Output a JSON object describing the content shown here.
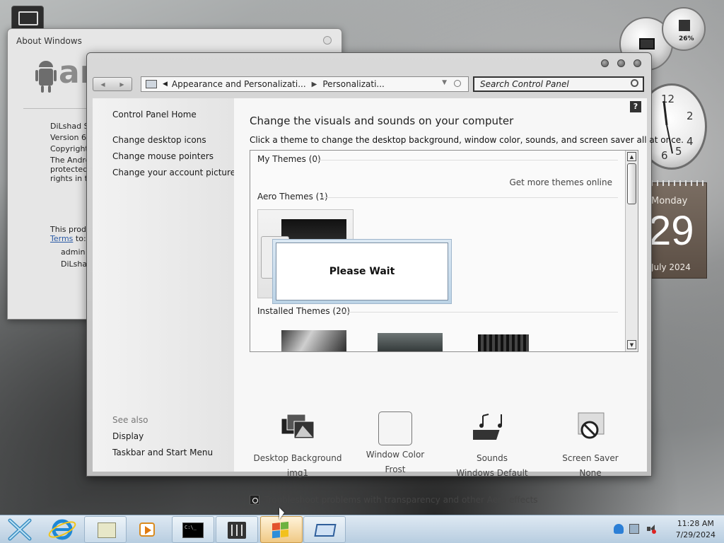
{
  "about_window": {
    "title": "About Windows",
    "logo_text": "ar",
    "lines": [
      "DiLshad Sys",
      "Version 6. 1",
      "Copyright",
      "The Androi",
      "protected b",
      "rights in th"
    ],
    "product_line": "This produc",
    "terms_link": "Terms",
    "terms_suffix": " to:",
    "users": [
      "admin",
      "DiLshad"
    ]
  },
  "gadgets": {
    "meter_value": "26%",
    "clock_numbers": [
      "12",
      "2",
      "4",
      "5",
      "6"
    ],
    "calendar": {
      "day": "Monday",
      "date": "29",
      "month": "July 2024"
    }
  },
  "control_panel": {
    "breadcrumb": [
      "Appearance and Personalizati...",
      "Personalizati..."
    ],
    "search_placeholder": "Search Control Panel",
    "left_nav": {
      "home": "Control Panel Home",
      "links": [
        "Change desktop icons",
        "Change mouse pointers",
        "Change your account picture"
      ],
      "see_also_label": "See also",
      "see_also": [
        "Display",
        "Taskbar and Start Menu"
      ]
    },
    "help_label": "?",
    "title": "Change the visuals and sounds on your computer",
    "description": "Click a theme to change the desktop background, window color, sounds, and screen saver all at once.",
    "themes": {
      "my_themes": "My Themes (0)",
      "get_more": "Get more themes online",
      "aero_themes": "Aero Themes (1)",
      "installed_themes": "Installed Themes (20)"
    },
    "wait_dialog": "Please Wait",
    "options": [
      {
        "label": "Desktop Background",
        "value": "img1",
        "icon": "desktop-background-icon"
      },
      {
        "label": "Window Color",
        "value": "Frost",
        "icon": "window-color-icon"
      },
      {
        "label": "Sounds",
        "value": "Windows Default",
        "icon": "sounds-icon"
      },
      {
        "label": "Screen Saver",
        "value": "None",
        "icon": "screen-saver-icon"
      }
    ],
    "troubleshoot": "Troubleshoot problems with transparency and other Aero effects"
  },
  "taskbar": {
    "time": "11:28 AM",
    "date": "7/29/2024"
  }
}
